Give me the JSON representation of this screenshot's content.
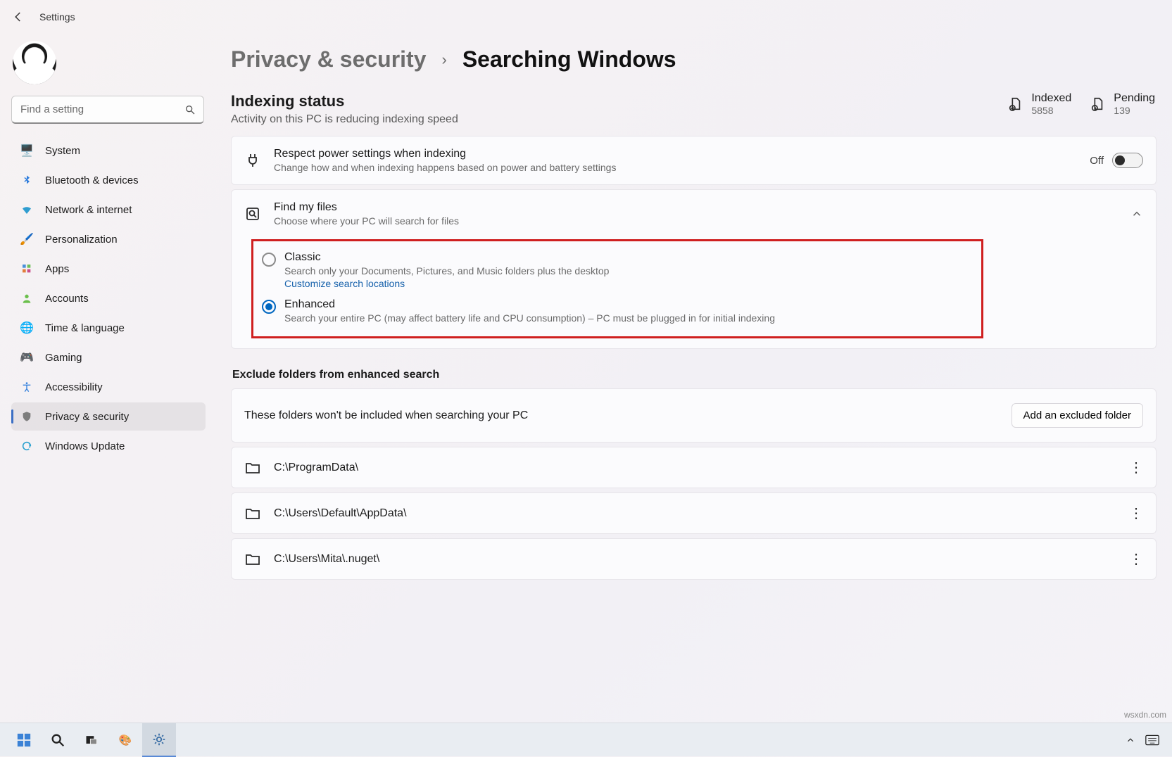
{
  "app": {
    "title": "Settings"
  },
  "search": {
    "placeholder": "Find a setting"
  },
  "nav": {
    "items": [
      {
        "label": "System"
      },
      {
        "label": "Bluetooth & devices"
      },
      {
        "label": "Network & internet"
      },
      {
        "label": "Personalization"
      },
      {
        "label": "Apps"
      },
      {
        "label": "Accounts"
      },
      {
        "label": "Time & language"
      },
      {
        "label": "Gaming"
      },
      {
        "label": "Accessibility"
      },
      {
        "label": "Privacy & security"
      },
      {
        "label": "Windows Update"
      }
    ]
  },
  "breadcrumb": {
    "parent": "Privacy & security",
    "current": "Searching Windows"
  },
  "indexing": {
    "title": "Indexing status",
    "subtitle": "Activity on this PC is reducing indexing speed",
    "indexed_label": "Indexed",
    "indexed_value": "5858",
    "pending_label": "Pending",
    "pending_value": "139"
  },
  "power": {
    "title": "Respect power settings when indexing",
    "desc": "Change how and when indexing happens based on power and battery settings",
    "state_label": "Off"
  },
  "find": {
    "title": "Find my files",
    "desc": "Choose where your PC will search for files",
    "classic_title": "Classic",
    "classic_desc": "Search only your Documents, Pictures, and Music folders plus the desktop",
    "classic_link": "Customize search locations",
    "enhanced_title": "Enhanced",
    "enhanced_desc": "Search your entire PC (may affect battery life and CPU consumption) – PC must be plugged in for initial indexing"
  },
  "exclude": {
    "section_title": "Exclude folders from enhanced search",
    "note": "These folders won't be included when searching your PC",
    "add_button": "Add an excluded folder",
    "folders": [
      "C:\\ProgramData\\",
      "C:\\Users\\Default\\AppData\\",
      "C:\\Users\\Mita\\.nuget\\"
    ]
  },
  "watermark": "wsxdn.com"
}
